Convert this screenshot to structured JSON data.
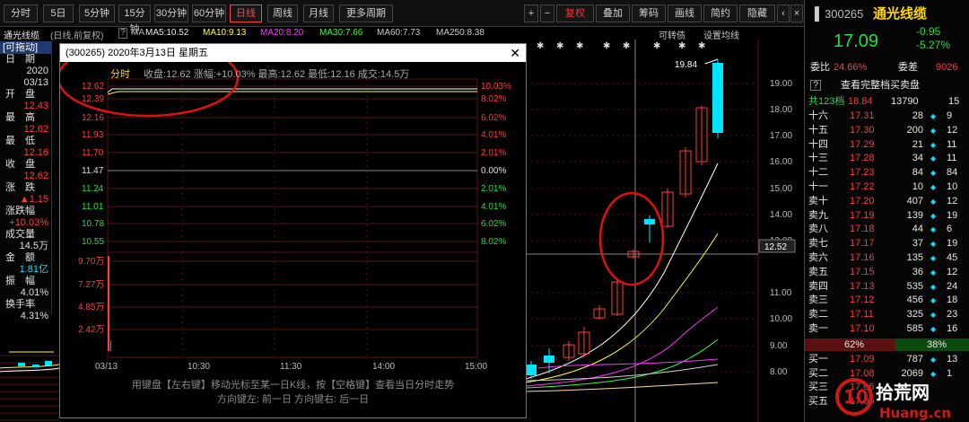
{
  "toolbar": {
    "buttons": [
      "分时",
      "5日",
      "5分钟",
      "15分钟",
      "30分钟",
      "60分钟",
      "日线",
      "周线",
      "月线",
      "更多周期"
    ],
    "active": "日线",
    "right_buttons": [
      "复权",
      "叠加",
      "筹码",
      "画线",
      "简约",
      "隐藏"
    ]
  },
  "ma_line": {
    "stock": "通光线缆",
    "period": "(日线,前复权)",
    "ma_label": "MA",
    "ma5": "MA5:10.52",
    "ma10": "MA10:9.13",
    "ma20": "MA20:8.20",
    "ma30": "MA30:7.66",
    "ma60": "MA60:7.73",
    "ma250": "MA250:8.38",
    "right1": "可转债",
    "right2": "设置均线"
  },
  "left_panel": {
    "title": "[可拖动]",
    "rows": [
      {
        "label": "日　期",
        "value": "2020",
        "value2": "03/13",
        "color": "#e0e0e0"
      },
      {
        "label": "开　盘",
        "value": "12.43",
        "color": "#ff3b3b"
      },
      {
        "label": "最　高",
        "value": "12.62",
        "color": "#ff3b3b"
      },
      {
        "label": "最　低",
        "value": "12.16",
        "color": "#ff3b3b"
      },
      {
        "label": "收　盘",
        "value": "12.62",
        "color": "#ff3b3b"
      },
      {
        "label": "涨　跌",
        "value": "▲1.15",
        "color": "#ff3b3b"
      },
      {
        "label": "涨跌幅",
        "value": "+10.03%",
        "color": "#ff3b3b"
      },
      {
        "label": "成交量",
        "value": "14.5万",
        "color": "#e0e0e0"
      },
      {
        "label": "金　额",
        "value": "1.81亿",
        "color": "#00e0ff"
      },
      {
        "label": "振　幅",
        "value": "4.01%",
        "color": "#e0e0e0"
      },
      {
        "label": "换手率",
        "value": "4.31%",
        "color": "#e0e0e0"
      }
    ]
  },
  "chart": {
    "peak_label": "19.84",
    "price_marker": "12.52",
    "y_ticks": [
      "19.00",
      "18.00",
      "17.00",
      "16.00",
      "15.00",
      "14.00",
      "13.00",
      "11.00",
      "10.00",
      "9.00",
      "8.00"
    ]
  },
  "popup": {
    "title": "(300265) 2020年3月13日 星期五",
    "tab": "分时",
    "info": "收盘:12.62  涨幅:+10.03%  最高:12.62  最低:12.16  成交:14.5万",
    "left_ticks": [
      "12.62",
      "12.39",
      "12.16",
      "11.93",
      "11.70",
      "11.47",
      "11.24",
      "11.01",
      "10.78",
      "10.55"
    ],
    "right_ticks": [
      "10.03%",
      "8.02%",
      "6.02%",
      "4.01%",
      "2.01%",
      "0.00%",
      "2.01%",
      "4.01%",
      "6.02%",
      "8.02%"
    ],
    "vol_ticks": [
      "9.70万",
      "7.27万",
      "4.85万",
      "2.42万"
    ],
    "x_ticks": [
      "03/13",
      "10:30",
      "11:30",
      "14:00",
      "15:00"
    ],
    "hint1": "用键盘【左右键】移动光标至某一日K线，按【空格键】查看当日分时走势",
    "hint2": "方向键左: 前一日    方向键右: 后一日"
  },
  "quote": {
    "code": "300265",
    "name": "通光线缆",
    "price": "17.09",
    "change": "-0.95",
    "pct": "-5.27%",
    "weibi_label": "委比",
    "weibi": "24.66%",
    "weicha_label": "委差",
    "weicha": "9026",
    "full_book": "查看完整档买卖盘",
    "total_label": "共123档",
    "total_price": "18.84",
    "total_vol": "13790",
    "total_n": "15",
    "sells": [
      {
        "label": "十六",
        "price": "17.31",
        "vol": "28",
        "n": "9"
      },
      {
        "label": "十五",
        "price": "17.30",
        "vol": "200",
        "n": "12"
      },
      {
        "label": "十四",
        "price": "17.29",
        "vol": "21",
        "n": "11"
      },
      {
        "label": "十三",
        "price": "17.28",
        "vol": "34",
        "n": "11"
      },
      {
        "label": "十二",
        "price": "17.23",
        "vol": "84",
        "n": "84"
      },
      {
        "label": "十一",
        "price": "17.22",
        "vol": "10",
        "n": "10"
      },
      {
        "label": "卖十",
        "price": "17.20",
        "vol": "407",
        "n": "12"
      },
      {
        "label": "卖九",
        "price": "17.19",
        "vol": "139",
        "n": "19"
      },
      {
        "label": "卖八",
        "price": "17.18",
        "vol": "44",
        "n": "6"
      },
      {
        "label": "卖七",
        "price": "17.17",
        "vol": "37",
        "n": "19"
      },
      {
        "label": "卖六",
        "price": "17.16",
        "vol": "135",
        "n": "45"
      },
      {
        "label": "卖五",
        "price": "17.15",
        "vol": "36",
        "n": "12"
      },
      {
        "label": "卖四",
        "price": "17.13",
        "vol": "535",
        "n": "24"
      },
      {
        "label": "卖三",
        "price": "17.12",
        "vol": "456",
        "n": "18"
      },
      {
        "label": "卖二",
        "price": "17.11",
        "vol": "325",
        "n": "23"
      },
      {
        "label": "卖一",
        "price": "17.10",
        "vol": "585",
        "n": "16"
      }
    ],
    "ratio_left": "62%",
    "ratio_right": "38%",
    "buys": [
      {
        "label": "买一",
        "price": "17.09",
        "vol": "787",
        "n": "13"
      },
      {
        "label": "买二",
        "price": "17.08",
        "vol": "2069",
        "n": "1"
      },
      {
        "label": "买三",
        "price": "17.06",
        "vol": "",
        "n": ""
      },
      {
        "label": "买五",
        "price": "17.05",
        "vol": "",
        "n": ""
      }
    ]
  },
  "watermark": {
    "text1": "拾荒网",
    "text2": "Huang.cn",
    "num": "10"
  }
}
